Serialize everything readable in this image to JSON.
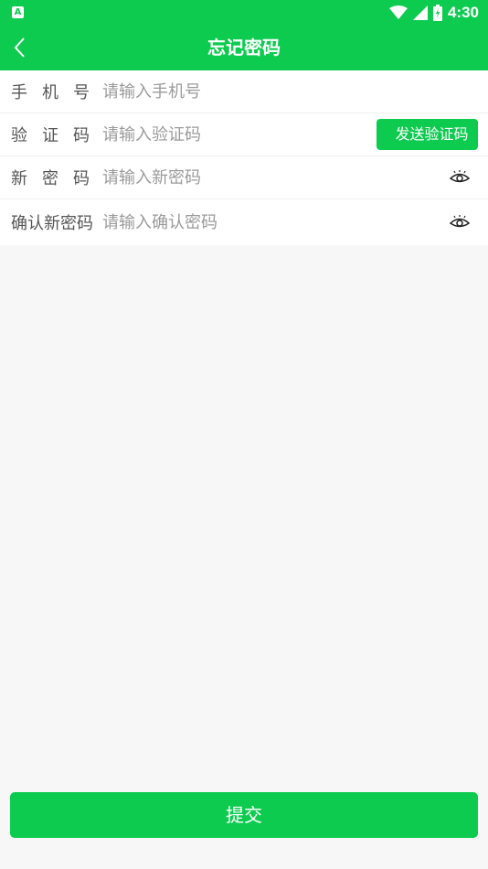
{
  "status_bar": {
    "time": "4:30",
    "app_icon": "A",
    "icons": [
      "wifi-icon",
      "cell-signal-icon",
      "battery-icon"
    ]
  },
  "app_bar": {
    "title": "忘记密码",
    "back_icon": "chevron-left-icon"
  },
  "form": {
    "phone": {
      "label": "手机号",
      "placeholder": "请输入手机号"
    },
    "code": {
      "label": "验证码",
      "placeholder": "请输入验证码",
      "send_button": "发送验证码"
    },
    "new_password": {
      "label": "新密码",
      "placeholder": "请输入新密码",
      "toggle_icon": "eye-icon"
    },
    "confirm_password": {
      "label": "确认新密码",
      "placeholder": "请输入确认密码",
      "toggle_icon": "eye-icon"
    }
  },
  "submit": {
    "label": "提交"
  },
  "colors": {
    "primary": "#0ccb4f",
    "background": "#f7f7f7",
    "label_text": "#555555",
    "placeholder_text": "#9a9a9a"
  }
}
